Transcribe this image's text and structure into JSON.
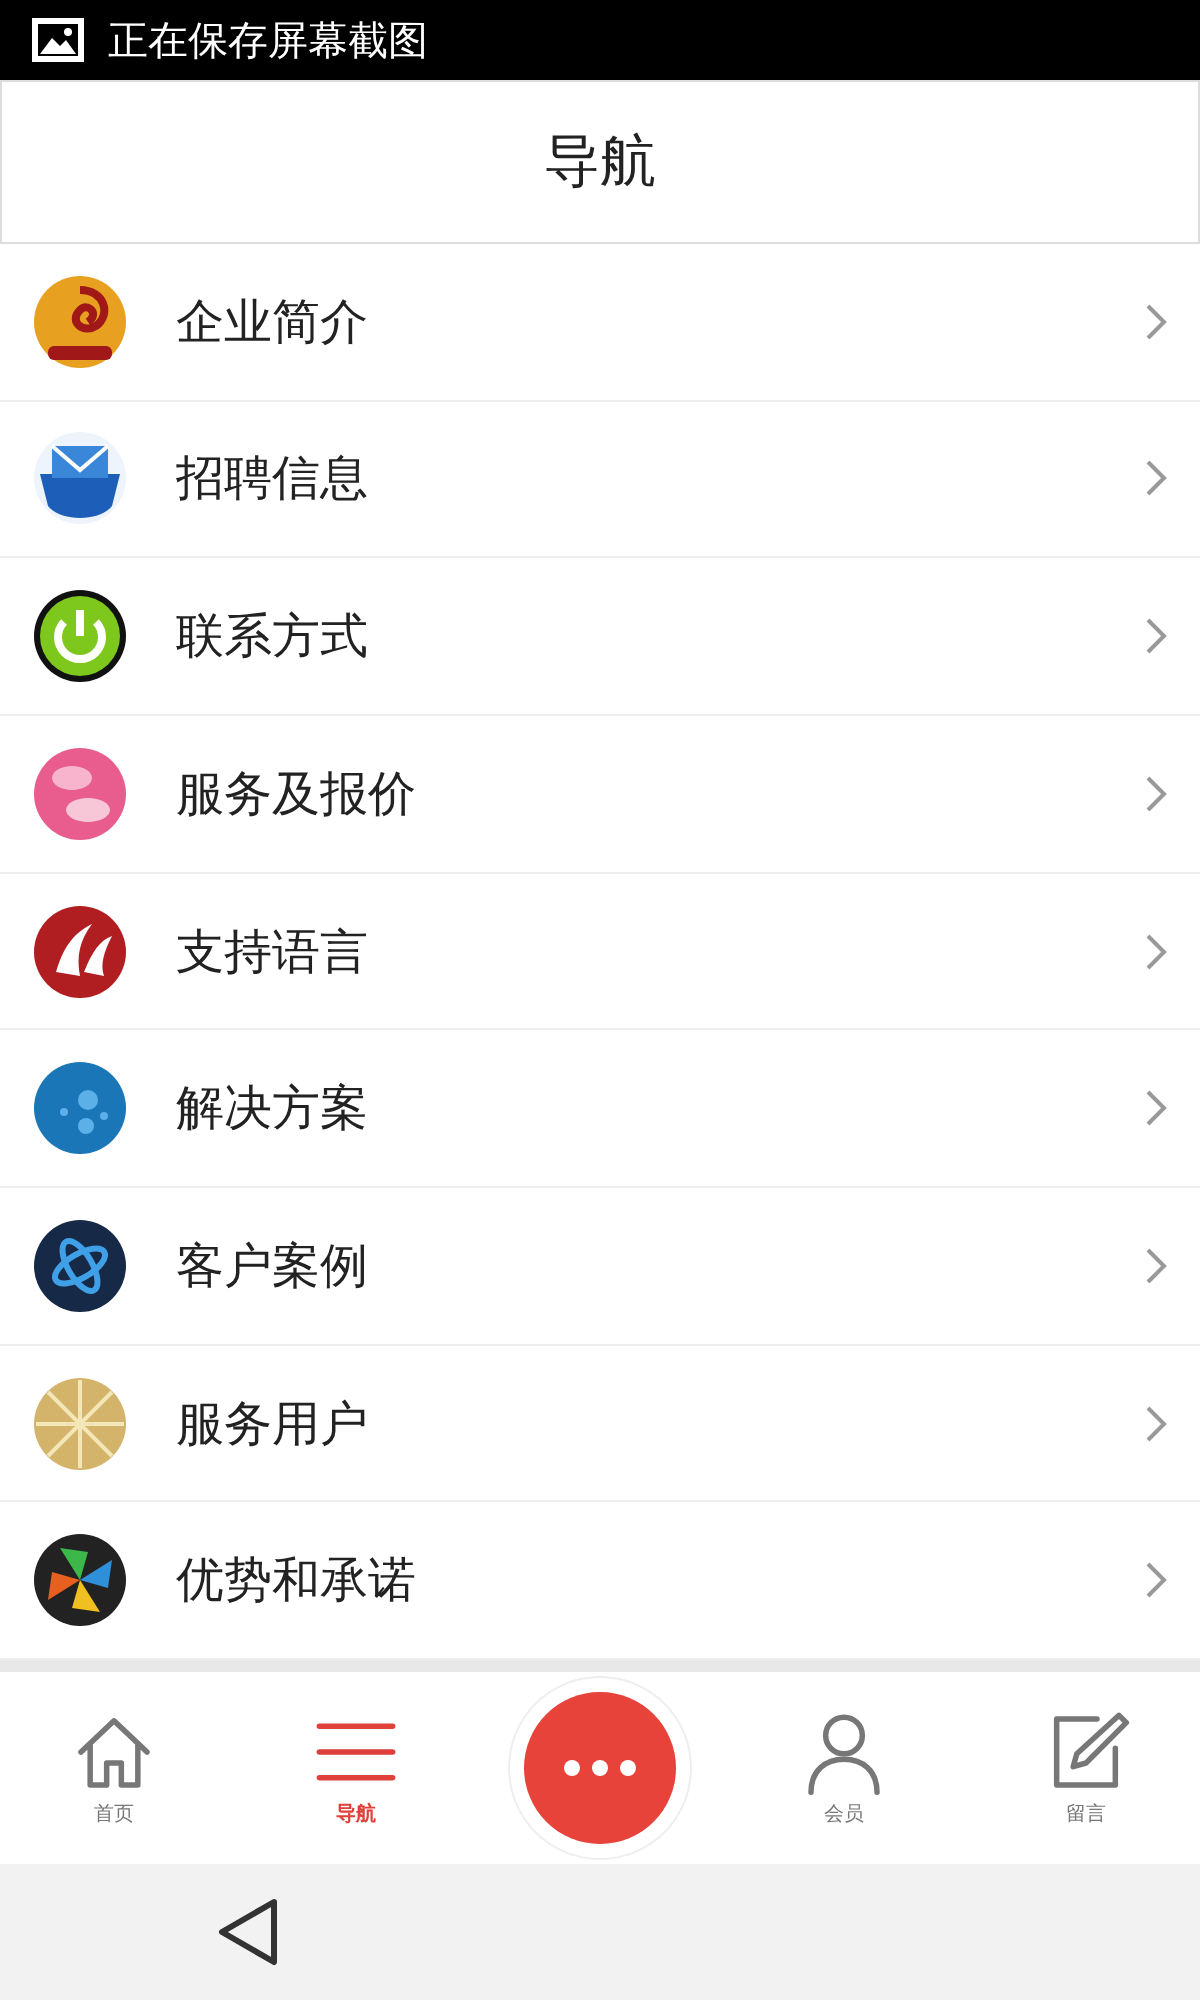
{
  "status_bar": {
    "text": "正在保存屏幕截图"
  },
  "header": {
    "title": "导航"
  },
  "menu": [
    {
      "label": "企业简介"
    },
    {
      "label": "招聘信息"
    },
    {
      "label": "联系方式"
    },
    {
      "label": "服务及报价"
    },
    {
      "label": "支持语言"
    },
    {
      "label": "解决方案"
    },
    {
      "label": "客户案例"
    },
    {
      "label": "服务用户"
    },
    {
      "label": "优势和承诺"
    }
  ],
  "bottom_nav": [
    {
      "label": "首页",
      "selected": false
    },
    {
      "label": "导航",
      "selected": true
    },
    {
      "label": "会员",
      "selected": false
    },
    {
      "label": "留言",
      "selected": false
    }
  ]
}
